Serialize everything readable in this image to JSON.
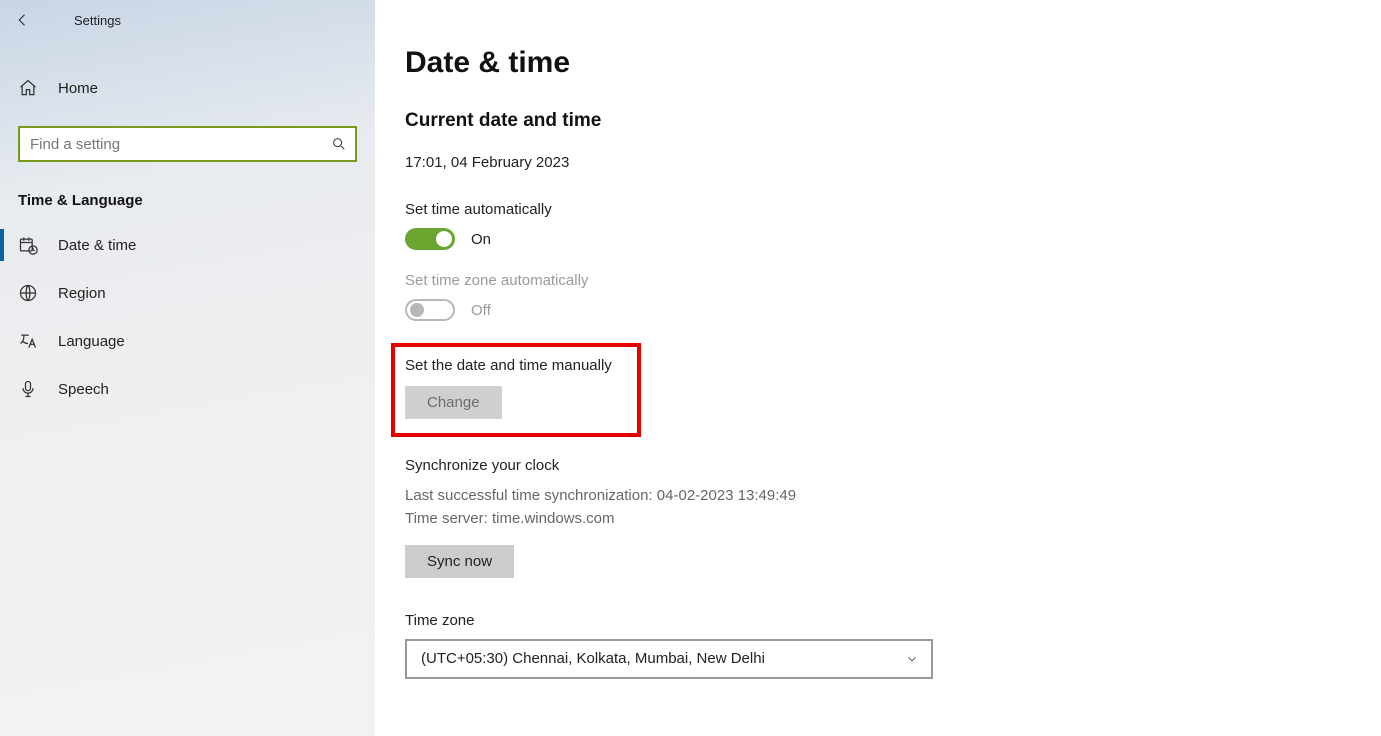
{
  "app": {
    "title": "Settings"
  },
  "sidebar": {
    "home_label": "Home",
    "search_placeholder": "Find a setting",
    "category": "Time & Language",
    "items": [
      {
        "label": "Date & time"
      },
      {
        "label": "Region"
      },
      {
        "label": "Language"
      },
      {
        "label": "Speech"
      }
    ]
  },
  "main": {
    "page_title": "Date & time",
    "current_title": "Current date and time",
    "current_value": "17:01, 04 February 2023",
    "auto_time": {
      "label": "Set time automatically",
      "state": "On",
      "on": true
    },
    "auto_tz": {
      "label": "Set time zone automatically",
      "state": "Off",
      "on": false
    },
    "manual": {
      "label": "Set the date and time manually",
      "button": "Change"
    },
    "sync": {
      "title": "Synchronize your clock",
      "last_label": "Last successful time synchronization:",
      "last_value": "04-02-2023 13:49:49",
      "server_label": "Time server:",
      "server_value": "time.windows.com",
      "button": "Sync now"
    },
    "timezone": {
      "label": "Time zone",
      "value": "(UTC+05:30) Chennai, Kolkata, Mumbai, New Delhi"
    }
  }
}
